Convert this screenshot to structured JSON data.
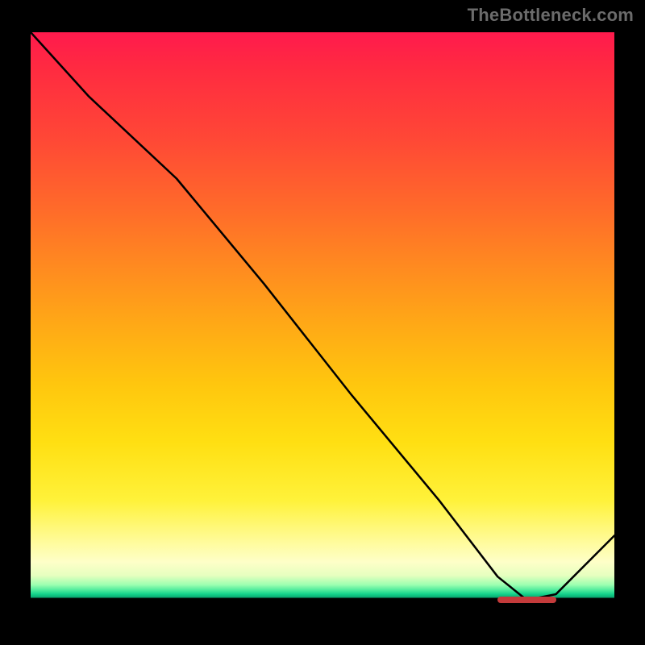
{
  "watermark": "TheBottleneck.com",
  "chart_data": {
    "type": "line",
    "title": "",
    "xlabel": "",
    "ylabel": "",
    "xlim": [
      0,
      100
    ],
    "ylim": [
      0,
      100
    ],
    "series": [
      {
        "name": "curve",
        "x": [
          0,
          10,
          25,
          40,
          55,
          70,
          80,
          85,
          90,
          100
        ],
        "y": [
          100,
          89,
          75,
          57,
          38,
          20,
          7,
          3,
          4,
          14
        ]
      }
    ],
    "annotations": [
      {
        "name": "red-segment",
        "x_start": 80,
        "x_end": 90,
        "y": 3
      }
    ],
    "gradient_stops": [
      {
        "pct": 0,
        "color": "#ff1a4d"
      },
      {
        "pct": 50,
        "color": "#ffa916"
      },
      {
        "pct": 80,
        "color": "#fff23a"
      },
      {
        "pct": 95,
        "color": "#12d28a"
      },
      {
        "pct": 100,
        "color": "#000000"
      }
    ]
  }
}
